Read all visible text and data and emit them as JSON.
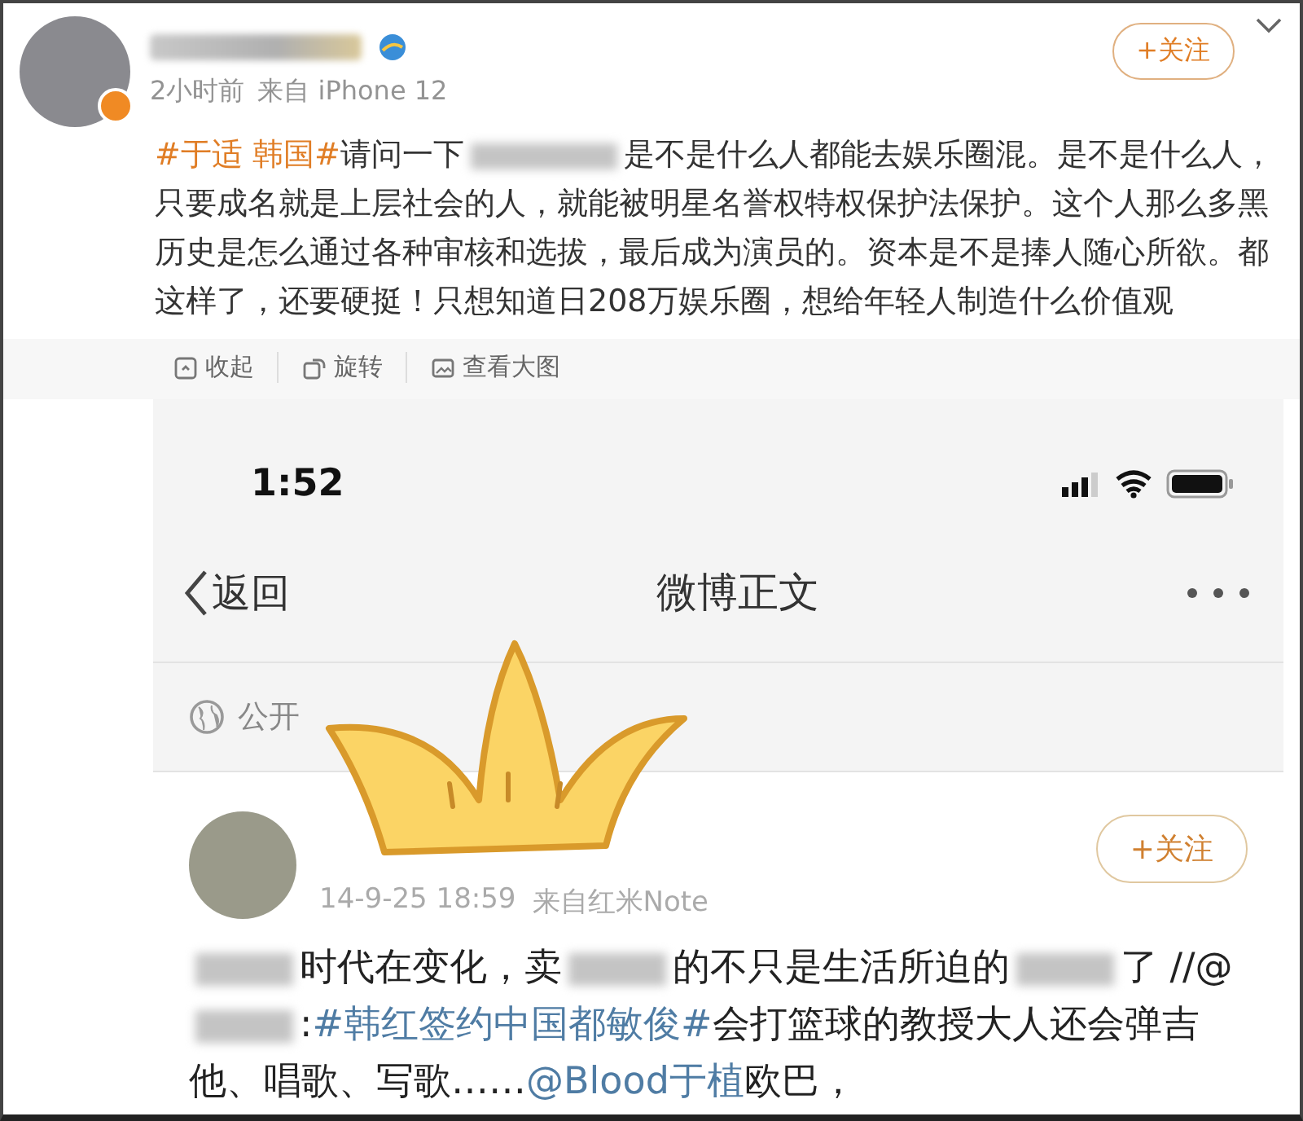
{
  "post": {
    "time": "2小时前",
    "source": "来自 iPhone 12",
    "verified": true,
    "follow_button": "+关注",
    "body": [
      {
        "kind": "hashtag",
        "text": "#于适 韩国#"
      },
      {
        "kind": "text",
        "text": "请问一下"
      },
      {
        "kind": "blur"
      },
      {
        "kind": "text",
        "text": "是不是什么人都能去娱乐圈混。是不是什么人，只要成名就是上层社会的人，就能被明星名誉权特权保护法保护。这个人那么多黑历史是怎么通过各种审核和选拔，最后成为演员的。资本是不是捧人随心所欲。都这样了，还要硬挺！只想知道日208万娱乐圈，想给年轻人制造什么价值观"
      }
    ],
    "actions": [
      {
        "kind": "collapse",
        "label": "收起"
      },
      {
        "kind": "rotate",
        "label": "旋转"
      },
      {
        "kind": "zoom",
        "label": "查看大图"
      }
    ]
  },
  "screenshot": {
    "status_time": "1:52",
    "back": "返回",
    "title": "微博正文",
    "visibility": "公开",
    "post": {
      "time": "14-9-25 18:59",
      "source": "来自红米Note",
      "follow_button": "+关注",
      "body": [
        {
          "kind": "blur"
        },
        {
          "kind": "text",
          "text": "时代在变化，卖"
        },
        {
          "kind": "blur"
        },
        {
          "kind": "text",
          "text": "的不只是生活所迫的"
        },
        {
          "kind": "blur"
        },
        {
          "kind": "text",
          "text": "了 //@"
        },
        {
          "kind": "blur"
        },
        {
          "kind": "text",
          "text": ":"
        },
        {
          "kind": "hashtag",
          "text": "#韩红签约中国都敏俊#"
        },
        {
          "kind": "text",
          "text": "会打篮球的教授大人还会弹吉他、唱歌、写歌……"
        },
        {
          "kind": "mention",
          "text": "@Blood于植"
        },
        {
          "kind": "text",
          "text": "欧巴，"
        }
      ]
    }
  }
}
